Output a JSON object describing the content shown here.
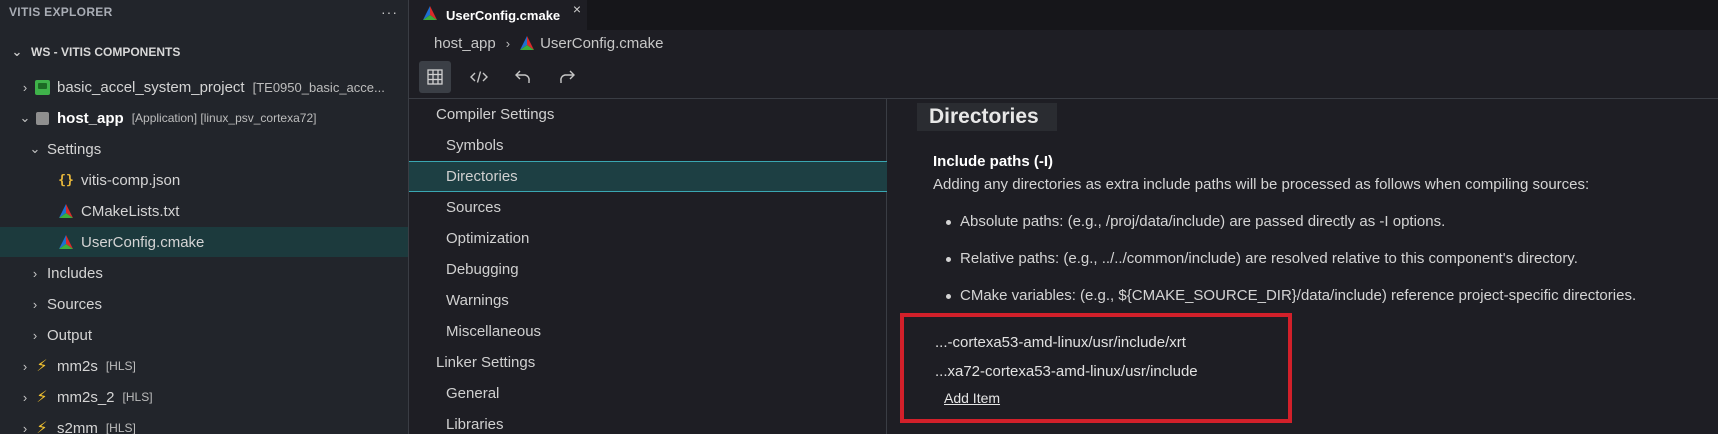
{
  "explorer": {
    "title": "VITIS EXPLORER",
    "more_label": "···",
    "workspace": "WS - VITIS COMPONENTS",
    "items": [
      {
        "label": "basic_accel_system_project",
        "tag": "[TE0950_basic_acce...",
        "icon": "system-project-icon"
      },
      {
        "label": "host_app",
        "tag": "[Application] [linux_psv_cortexa72]",
        "icon": "chip-icon"
      },
      {
        "label": "Settings"
      },
      {
        "label": "vitis-comp.json",
        "icon": "json-icon",
        "icon_glyph": "{}"
      },
      {
        "label": "CMakeLists.txt",
        "icon": "cmake-icon"
      },
      {
        "label": "UserConfig.cmake",
        "icon": "cmake-icon"
      },
      {
        "label": "Includes"
      },
      {
        "label": "Sources"
      },
      {
        "label": "Output"
      },
      {
        "label": "mm2s",
        "tag": "[HLS]",
        "icon": "hls-bolt-icon",
        "icon_glyph": "⚡"
      },
      {
        "label": "mm2s_2",
        "tag": "[HLS]",
        "icon": "hls-bolt-icon",
        "icon_glyph": "⚡"
      },
      {
        "label": "s2mm",
        "tag": "[HLS]",
        "icon": "hls-bolt-icon",
        "icon_glyph": "⚡"
      }
    ]
  },
  "tab": {
    "title": "UserConfig.cmake",
    "close_label": "×"
  },
  "breadcrumb": {
    "part1": "host_app",
    "part2": "UserConfig.cmake"
  },
  "toolbar": {
    "icons": [
      "table-view-icon",
      "code-view-icon",
      "undo-icon",
      "redo-icon"
    ]
  },
  "settings_nav": {
    "compiler_group": "Compiler Settings",
    "compiler_items": [
      "Symbols",
      "Directories",
      "Sources",
      "Optimization",
      "Debugging",
      "Warnings",
      "Miscellaneous"
    ],
    "linker_group": "Linker Settings",
    "linker_items": [
      "General",
      "Libraries"
    ],
    "selected": "Directories"
  },
  "content": {
    "heading": "Directories",
    "include_title": "Include paths (-I)",
    "include_desc": "Adding any directories as extra include paths will be processed as follows when compiling sources:",
    "bullets": [
      "Absolute paths: (e.g., /proj/data/include) are passed directly as -I options.",
      "Relative paths: (e.g., ../../common/include) are resolved relative to this component's directory.",
      "CMake variables: (e.g., ${CMAKE_SOURCE_DIR}/data/include) reference project-specific directories."
    ],
    "paths": [
      "...-cortexa53-amd-linux/usr/include/xrt",
      "...xa72-cortexa53-amd-linux/usr/include"
    ],
    "add_item_label": "Add Item"
  },
  "colors": {
    "highlight_border": "#d2202a",
    "selected_nav": "#1d3f43",
    "accent_line": "#3aa7b2"
  }
}
